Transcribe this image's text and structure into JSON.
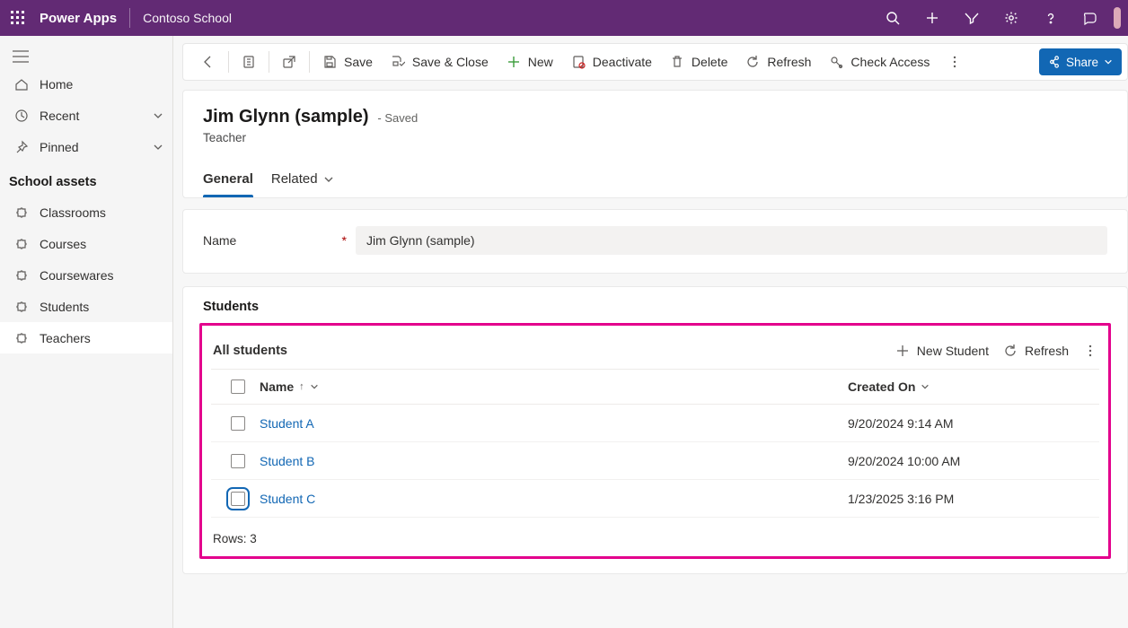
{
  "topbar": {
    "app_name": "Power Apps",
    "environment": "Contoso School"
  },
  "leftnav": {
    "home": "Home",
    "recent": "Recent",
    "pinned": "Pinned",
    "section": "School assets",
    "items": [
      {
        "label": "Classrooms"
      },
      {
        "label": "Courses"
      },
      {
        "label": "Coursewares"
      },
      {
        "label": "Students"
      },
      {
        "label": "Teachers"
      }
    ]
  },
  "commands": {
    "save": "Save",
    "save_close": "Save & Close",
    "new": "New",
    "deactivate": "Deactivate",
    "delete": "Delete",
    "refresh": "Refresh",
    "check_access": "Check Access",
    "share": "Share"
  },
  "record": {
    "title": "Jim Glynn (sample)",
    "saved_suffix": "- Saved",
    "subtitle": "Teacher",
    "tabs": {
      "general": "General",
      "related": "Related"
    },
    "name_field": {
      "label": "Name",
      "value": "Jim Glynn (sample)"
    }
  },
  "students_section": {
    "heading": "Students",
    "subgrid_title": "All students",
    "new_student": "New Student",
    "refresh": "Refresh",
    "columns": {
      "name": "Name",
      "created_on": "Created On"
    },
    "rows": [
      {
        "name": "Student A",
        "created": "9/20/2024 9:14 AM"
      },
      {
        "name": "Student B",
        "created": "9/20/2024 10:00 AM"
      },
      {
        "name": "Student C",
        "created": "1/23/2025 3:16 PM"
      }
    ],
    "footer_label": "Rows:",
    "footer_count": "3"
  }
}
